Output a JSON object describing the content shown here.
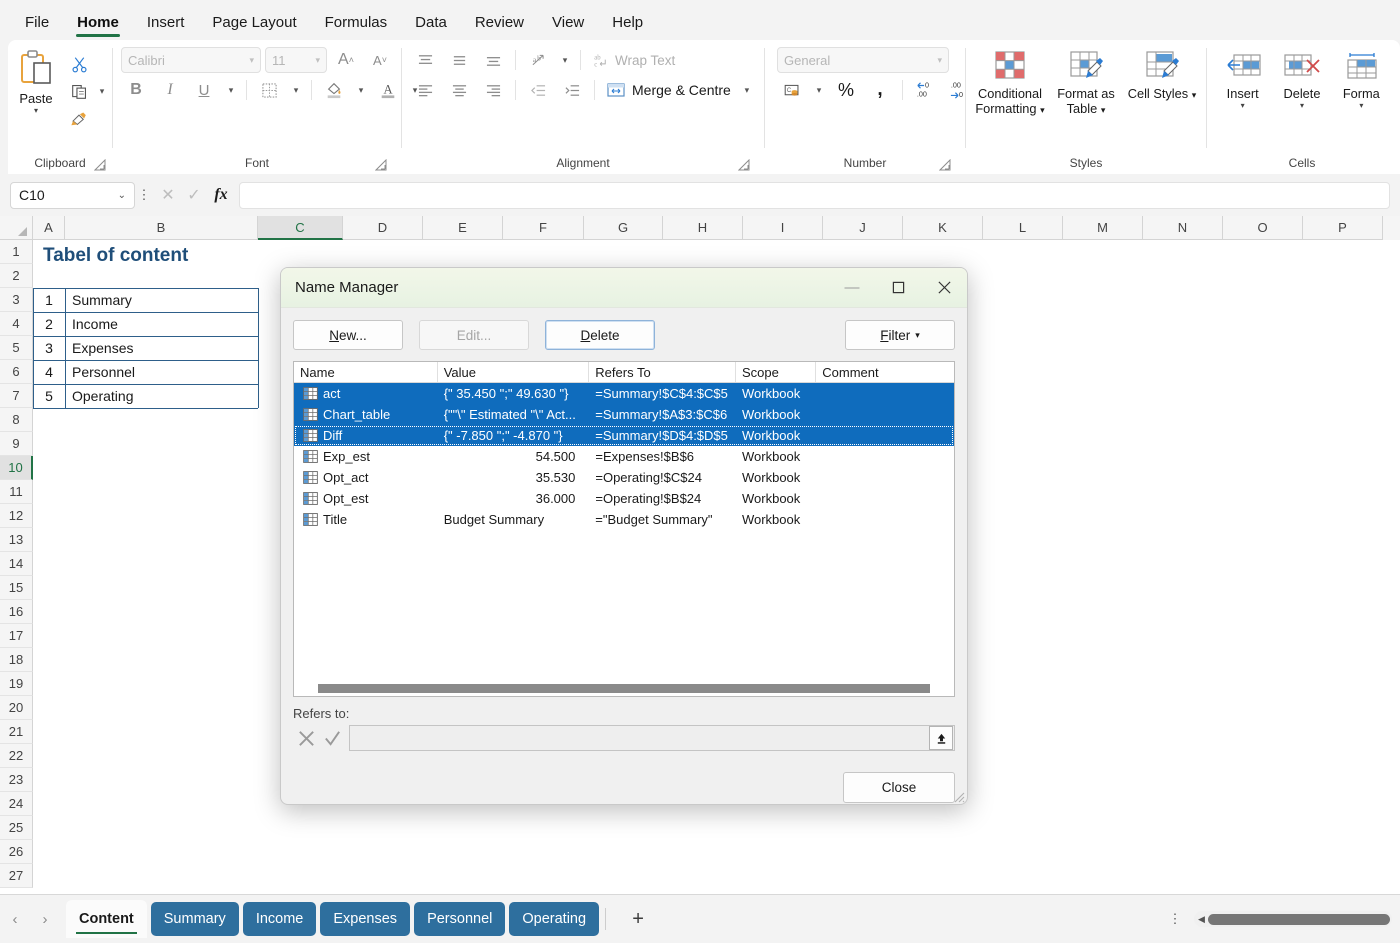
{
  "ribbon": {
    "tabs": [
      {
        "label": "File"
      },
      {
        "label": "Home"
      },
      {
        "label": "Insert"
      },
      {
        "label": "Page Layout"
      },
      {
        "label": "Formulas"
      },
      {
        "label": "Data"
      },
      {
        "label": "Review"
      },
      {
        "label": "View"
      },
      {
        "label": "Help"
      }
    ],
    "active_tab": "Home",
    "clipboard": {
      "group_label": "Clipboard",
      "paste_label": "Paste",
      "cut_icon": "scissors-icon",
      "copy_icon": "copy-icon",
      "format_painter_icon": "format-painter-icon"
    },
    "font": {
      "group_label": "Font",
      "font_name": "Calibri",
      "font_size": "11",
      "bold": "B",
      "italic": "I",
      "underline": "U",
      "grow_font": "A",
      "shrink_font": "A"
    },
    "alignment": {
      "group_label": "Alignment",
      "wrap_text": "Wrap Text",
      "merge_centre": "Merge & Centre"
    },
    "number": {
      "group_label": "Number",
      "format": "General",
      "percent": "%",
      "comma": ","
    },
    "styles": {
      "group_label": "Styles",
      "conditional_formatting": "Conditional Formatting",
      "format_as_table": "Format as Table",
      "cell_styles": "Cell Styles"
    },
    "cells": {
      "group_label": "Cells",
      "insert": "Insert",
      "delete": "Delete",
      "format": "Forma"
    }
  },
  "formula_bar": {
    "name_box": "C10",
    "formula_value": "",
    "cancel_icon": "cancel-icon",
    "enter_icon": "enter-icon",
    "fx_label": "fx"
  },
  "grid": {
    "columns": [
      "A",
      "B",
      "C",
      "D",
      "E",
      "F",
      "G",
      "H",
      "I",
      "J",
      "K",
      "L",
      "M",
      "N",
      "O",
      "P"
    ],
    "selected_column": "C",
    "rows": [
      1,
      2,
      3,
      4,
      5,
      6,
      7,
      8,
      9,
      10,
      11,
      12,
      13,
      14,
      15,
      16,
      17,
      18,
      19,
      20,
      21,
      22,
      23,
      24,
      25,
      26,
      27
    ],
    "selected_row": 10,
    "title": "Tabel of content",
    "toc": [
      {
        "num": "1",
        "label": "Summary"
      },
      {
        "num": "2",
        "label": "Income"
      },
      {
        "num": "3",
        "label": "Expenses"
      },
      {
        "num": "4",
        "label": "Personnel"
      },
      {
        "num": "5",
        "label": "Operating"
      }
    ]
  },
  "dialog": {
    "title": "Name Manager",
    "minimize_icon": "minimize-icon",
    "maximize_icon": "maximize-icon",
    "close_icon": "close-icon",
    "buttons": {
      "new": "New...",
      "edit": "Edit...",
      "delete": "Delete",
      "filter": "Filter",
      "close": "Close"
    },
    "columns": [
      "Name",
      "Value",
      "Refers To",
      "Scope",
      "Comment"
    ],
    "names": [
      {
        "name": "act",
        "value": "{\" 35.450 \";\" 49.630 \"}",
        "refers_to": "=Summary!$C$4:$C$5",
        "scope": "Workbook",
        "comment": "",
        "selected": true,
        "focused": false
      },
      {
        "name": "Chart_table",
        "value": "{\"\"\\\" Estimated \"\\\" Act...",
        "refers_to": "=Summary!$A$3:$C$6",
        "scope": "Workbook",
        "comment": "",
        "selected": true,
        "focused": false
      },
      {
        "name": "Diff",
        "value": "{\" -7.850 \";\" -4.870 \"}",
        "refers_to": "=Summary!$D$4:$D$5",
        "scope": "Workbook",
        "comment": "",
        "selected": true,
        "focused": true
      },
      {
        "name": "Exp_est",
        "value": "54.500",
        "refers_to": "=Expenses!$B$6",
        "scope": "Workbook",
        "comment": "",
        "selected": false,
        "focused": false
      },
      {
        "name": "Opt_act",
        "value": "35.530",
        "refers_to": "=Operating!$C$24",
        "scope": "Workbook",
        "comment": "",
        "selected": false,
        "focused": false
      },
      {
        "name": "Opt_est",
        "value": "36.000",
        "refers_to": "=Operating!$B$24",
        "scope": "Workbook",
        "comment": "",
        "selected": false,
        "focused": false
      },
      {
        "name": "Title",
        "value": "Budget Summary",
        "refers_to": "=\"Budget Summary\"",
        "scope": "Workbook",
        "comment": "",
        "selected": false,
        "focused": false
      }
    ],
    "refers_to_label": "Refers to:",
    "refers_to_value": "",
    "cancel_icon": "cancel-icon",
    "confirm_icon": "confirm-icon",
    "collapse_icon": "collapse-dialog-icon"
  },
  "sheets": {
    "prev_icon": "prev-sheet-icon",
    "next_icon": "next-sheet-icon",
    "add_icon": "add-sheet-icon",
    "tabs": [
      {
        "label": "Content",
        "active": true,
        "colored": false
      },
      {
        "label": "Summary",
        "active": false,
        "colored": true
      },
      {
        "label": "Income",
        "active": false,
        "colored": true
      },
      {
        "label": "Expenses",
        "active": false,
        "colored": true
      },
      {
        "label": "Personnel",
        "active": false,
        "colored": true
      },
      {
        "label": "Operating",
        "active": false,
        "colored": true
      }
    ],
    "more_icon": "more-options-icon"
  },
  "colors": {
    "accent_green": "#217346",
    "tab_blue": "#2e6f9e",
    "selection_blue": "#0f6cbd",
    "title_text": "#1f4e79"
  }
}
